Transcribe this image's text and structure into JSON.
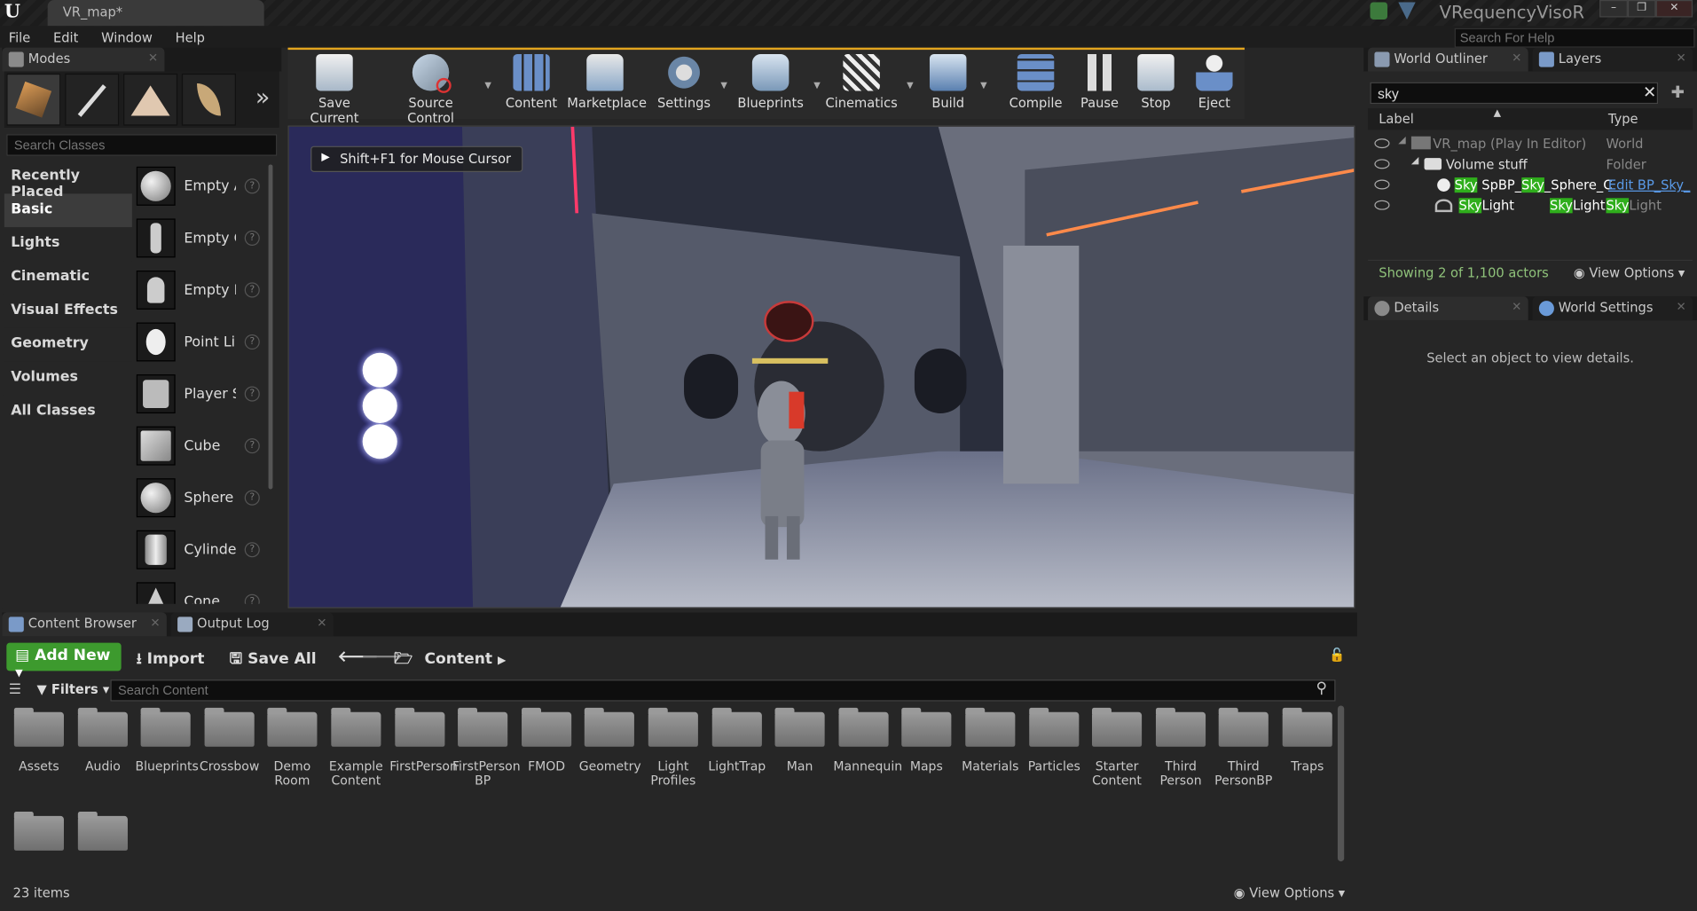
{
  "window": {
    "tab_title": "VR_map*",
    "project_name": "VRequencyVisoR",
    "help_search_placeholder": "Search For Help",
    "minimize": "–",
    "restore": "❐",
    "close": "✕"
  },
  "menu": [
    "File",
    "Edit",
    "Window",
    "Help"
  ],
  "modes_panel": {
    "tab": "Modes",
    "search_placeholder": "Search Classes",
    "categories": [
      "Recently Placed",
      "Basic",
      "Lights",
      "Cinematic",
      "Visual Effects",
      "Geometry",
      "Volumes",
      "All Classes"
    ],
    "selected_category": "Basic",
    "placeables": [
      "Empty Actor",
      "Empty Character",
      "Empty Pawn",
      "Point Light",
      "Player Start",
      "Cube",
      "Sphere",
      "Cylinder",
      "Cone"
    ]
  },
  "toolbar": {
    "buttons": [
      {
        "label": "Save Current",
        "icon": "save-icon"
      },
      {
        "label": "Source Control",
        "icon": "source-control-icon"
      },
      {
        "label": "Content",
        "icon": "content-icon"
      },
      {
        "label": "Marketplace",
        "icon": "marketplace-icon"
      },
      {
        "label": "Settings",
        "icon": "settings-icon"
      },
      {
        "label": "Blueprints",
        "icon": "blueprints-icon"
      },
      {
        "label": "Cinematics",
        "icon": "cinematics-icon"
      },
      {
        "label": "Build",
        "icon": "build-icon"
      },
      {
        "label": "Compile",
        "icon": "compile-icon"
      },
      {
        "label": "Pause",
        "icon": "pause-icon"
      },
      {
        "label": "Stop",
        "icon": "stop-icon"
      },
      {
        "label": "Eject",
        "icon": "eject-icon"
      }
    ]
  },
  "viewport": {
    "hint": "Shift+F1 for Mouse Cursor"
  },
  "world_outliner": {
    "tab": "World Outliner",
    "tab2": "Layers",
    "search_value": "sky",
    "col_label": "Label",
    "col_type": "Type",
    "rows": [
      {
        "label": "VR_map (Play In Editor)",
        "type": "World"
      },
      {
        "label": "Volume stuff",
        "type": "Folder"
      },
      {
        "label_hl": "Sky",
        "label_rest": "SpBP_",
        "label_hl2": "Sky",
        "label_rest2": "_Sphere_C",
        "type": "Edit BP_Sky_"
      },
      {
        "label_hl": "Sky",
        "label_rest": "Light",
        "type_pre": "Sky",
        "type_rest": "Light",
        "type_hl": "Sky",
        "type_rest2": "Light"
      }
    ],
    "footer": "Showing 2 of 1,100 actors",
    "view_options": "View Options"
  },
  "details": {
    "tab": "Details",
    "tab2": "World Settings",
    "message": "Select an object to view details."
  },
  "content_browser": {
    "tab": "Content Browser",
    "tab2": "Output Log",
    "add_new": "Add New",
    "import": "Import",
    "save_all": "Save All",
    "path": "Content",
    "filters": "Filters",
    "search_placeholder": "Search Content",
    "folders": [
      "Assets",
      "Audio",
      "Blueprints",
      "Crossbow",
      "Demo Room",
      "Example Content",
      "FirstPerson",
      "FirstPerson BP",
      "FMOD",
      "Geometry",
      "Light Profiles",
      "LightTrap",
      "Man",
      "Mannequin",
      "Maps",
      "Materials",
      "Particles",
      "Starter Content",
      "Third Person",
      "Third PersonBP",
      "Traps",
      "",
      ""
    ],
    "status": "23 items",
    "view_options": "View Options"
  },
  "colors": {
    "accent_orange": "#e3a51e",
    "add_new_green": "#3d9a2e",
    "search_highlight": "#2fae1c"
  }
}
